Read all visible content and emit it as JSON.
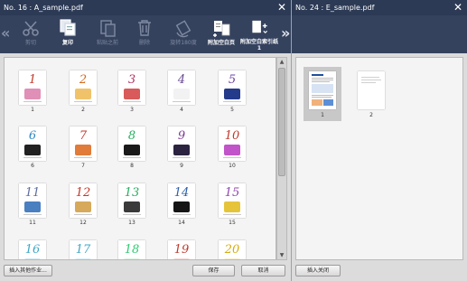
{
  "left_window": {
    "title": "No. 16 : A_sample.pdf"
  },
  "right_window": {
    "title": "No. 24 : E_sample.pdf"
  },
  "close_glyph": "✕",
  "toolbar": {
    "prev_glyph": "«",
    "next_glyph": "»",
    "tools": [
      {
        "label": "剪切",
        "icon": "scissors-icon",
        "enabled": false
      },
      {
        "label": "复印",
        "icon": "copy-icon",
        "enabled": true
      },
      {
        "label": "粘贴之前",
        "icon": "paste-icon",
        "enabled": false
      },
      {
        "label": "删除",
        "icon": "trash-icon",
        "enabled": false
      },
      {
        "label": "旋转180度",
        "icon": "rotate-icon",
        "enabled": false
      },
      {
        "label": "附加空白页",
        "icon": "blank-page-icon",
        "enabled": true
      },
      {
        "label": "附加空白索引纸1",
        "icon": "index-sheet-icon",
        "enabled": true
      }
    ]
  },
  "left_pages": {
    "items": [
      {
        "n": "1",
        "color": "#c0392b",
        "art": "#e08fb6"
      },
      {
        "n": "2",
        "color": "#d2691e",
        "art": "#f0c36a"
      },
      {
        "n": "3",
        "color": "#b03060",
        "art": "#d85a5a"
      },
      {
        "n": "4",
        "color": "#6a4c93",
        "art": "#f2f2f2"
      },
      {
        "n": "5",
        "color": "#6b3fa0",
        "art": "#243a8a"
      },
      {
        "n": "6",
        "color": "#2e86c1",
        "art": "#222222"
      },
      {
        "n": "7",
        "color": "#c0392b",
        "art": "#e07b39"
      },
      {
        "n": "8",
        "color": "#27ae60",
        "art": "#1a1a1a"
      },
      {
        "n": "9",
        "color": "#7d3c98",
        "art": "#2b2340"
      },
      {
        "n": "10",
        "color": "#c0392b",
        "art": "#c054c8"
      },
      {
        "n": "11",
        "color": "#5d6d9e",
        "art": "#4a7fc0"
      },
      {
        "n": "12",
        "color": "#c0392b",
        "art": "#d6aa5a"
      },
      {
        "n": "13",
        "color": "#27ae60",
        "art": "#3a3a3a"
      },
      {
        "n": "14",
        "color": "#2e5fa8",
        "art": "#151515"
      },
      {
        "n": "15",
        "color": "#8e44ad",
        "art": "#e6c43a"
      },
      {
        "n": "16",
        "color": "#3fa7c7",
        "art": "#cfe6f0"
      },
      {
        "n": "17",
        "color": "#3fa7c7",
        "art": "#d6eef6"
      },
      {
        "n": "18",
        "color": "#2ecc71",
        "art": "#d8f2df"
      },
      {
        "n": "19",
        "color": "#c0392b",
        "art": "#f5d3d3"
      },
      {
        "n": "20",
        "color": "#d4ac0d",
        "art": "#f5ecc8"
      }
    ]
  },
  "right_pages": {
    "items": [
      {
        "n": "1"
      },
      {
        "n": "2"
      }
    ]
  },
  "buttons": {
    "insert_other_job": "插入其他作业...",
    "save": "保存",
    "cancel": "取消",
    "insert_close": "插入关闭"
  }
}
